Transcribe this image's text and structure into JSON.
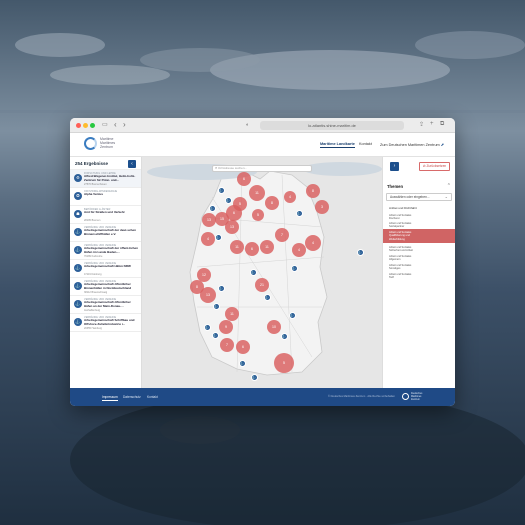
{
  "browser": {
    "url": "lo-atlantis.shine-maritim.de"
  },
  "site": {
    "logo_lines": [
      "Maritime",
      "Maritimes",
      "Zentrum"
    ],
    "menu": [
      "Maritime Landkarte",
      "Kontakt",
      "Zum Deutschen Maritimen Zentrum"
    ],
    "menu_arrow": "⬈"
  },
  "results": {
    "count": "254 Ergebnisse",
    "items": [
      {
        "cat": "FORSCHUNG UND LEHRE",
        "name": "Alfred-Wegener-Institut, Helm-holtz-Zentrum für Polar- und...",
        "loc": "27570 Bremerhaven",
        "icon": "⚙"
      },
      {
        "cat": "OFFSHORE-WINDENERGIE",
        "name": "Alpha Ventus",
        "loc": "",
        "icon": "✪"
      },
      {
        "cat": "BEHÖRDEN & ÄMTER",
        "name": "Amt für Straßen und Verkehr",
        "loc": "28195 Bremen",
        "icon": "☗"
      },
      {
        "cat": "VERBÄNDE UND VEREINE",
        "name": "Arbeitsgemeinschaft der deut-schen Binnenschiffhäfen e.V.",
        "loc": "",
        "icon": "⚓"
      },
      {
        "cat": "VERBÄNDE UND VEREINE",
        "name": "Arbeitsgemeinschaft der öffent-lichen Häfen im Lande Baden-...",
        "loc": "76189 Karlsruhe",
        "icon": "⚓"
      },
      {
        "cat": "VERBÄNDE UND VEREINE",
        "name": "Arbeitsgemeinschaft Häfen NRW",
        "loc": "47119 Duisburg",
        "icon": "⚓"
      },
      {
        "cat": "VERBÄNDE UND VEREINE",
        "name": "Arbeitsgemeinschaft öffentlicher Binnenhäfen in Norddeutschland",
        "loc": "38112 Braunschweig",
        "icon": "⚓"
      },
      {
        "cat": "VERBÄNDE UND VEREINE",
        "name": "Arbeitsgemeinschaft öffentlicher Häfen an der Main-Donau-...",
        "loc": "Aschaffenburg",
        "icon": "⚓"
      },
      {
        "cat": "VERBÄNDE UND VEREINE",
        "name": "Arbeitsgemeinschaft Schiffbau und Offshore-Zulieferindustrie i...",
        "loc": "20355 Hamburg",
        "icon": "⚓"
      }
    ]
  },
  "map": {
    "search_placeholder": "Ort/Adresse suchen...",
    "clusters": [
      "6",
      "11",
      "5",
      "8",
      "5",
      "4",
      "8",
      "3",
      "13",
      "15",
      "13",
      "6",
      "4",
      "11",
      "6",
      "11",
      "7",
      "4",
      "4",
      "12",
      "8",
      "13",
      "21",
      "11",
      "9",
      "10",
      "7",
      "6",
      "5"
    ]
  },
  "filters": {
    "reset_label": "⊘ Zurücksetzen",
    "section_title": "Themen",
    "select_placeholder": "Auswählen oder eingeben...",
    "opt1": "Anbiet und Dichtfahrt",
    "opt2_lines": [
      "Arbeit und Soziales",
      "Fischerei"
    ],
    "opt3_lines": [
      "Arbeit und Soziales",
      "Sozialpartner"
    ],
    "highlight_lines": [
      "Arbeit und Soziales",
      "Qualifizierung und",
      "Weiterbildung"
    ],
    "opt4_lines": [
      "Arbeit und Soziales",
      "Sicherheit und Arbeit"
    ],
    "opt5_lines": [
      "Arbeit und Soziales",
      "Allgemein"
    ],
    "opt6_lines": [
      "Arbeit und Soziales",
      "Sonstiges"
    ],
    "opt7_lines": [
      "Arbeit und Soziales",
      "Tarif"
    ]
  },
  "footer": {
    "links": [
      "Impressum",
      "Datenschutz",
      "Kontakt"
    ],
    "copyright": "© Deutsches Maritimes Zentrum · Alle Rechte vorbehalten",
    "logo_lines": [
      "Deutsches",
      "Maritimes",
      "Zentrum"
    ]
  },
  "colors": {
    "primary": "#1c4f8c",
    "cluster": "#d95e5e",
    "accent": "#d06464"
  }
}
